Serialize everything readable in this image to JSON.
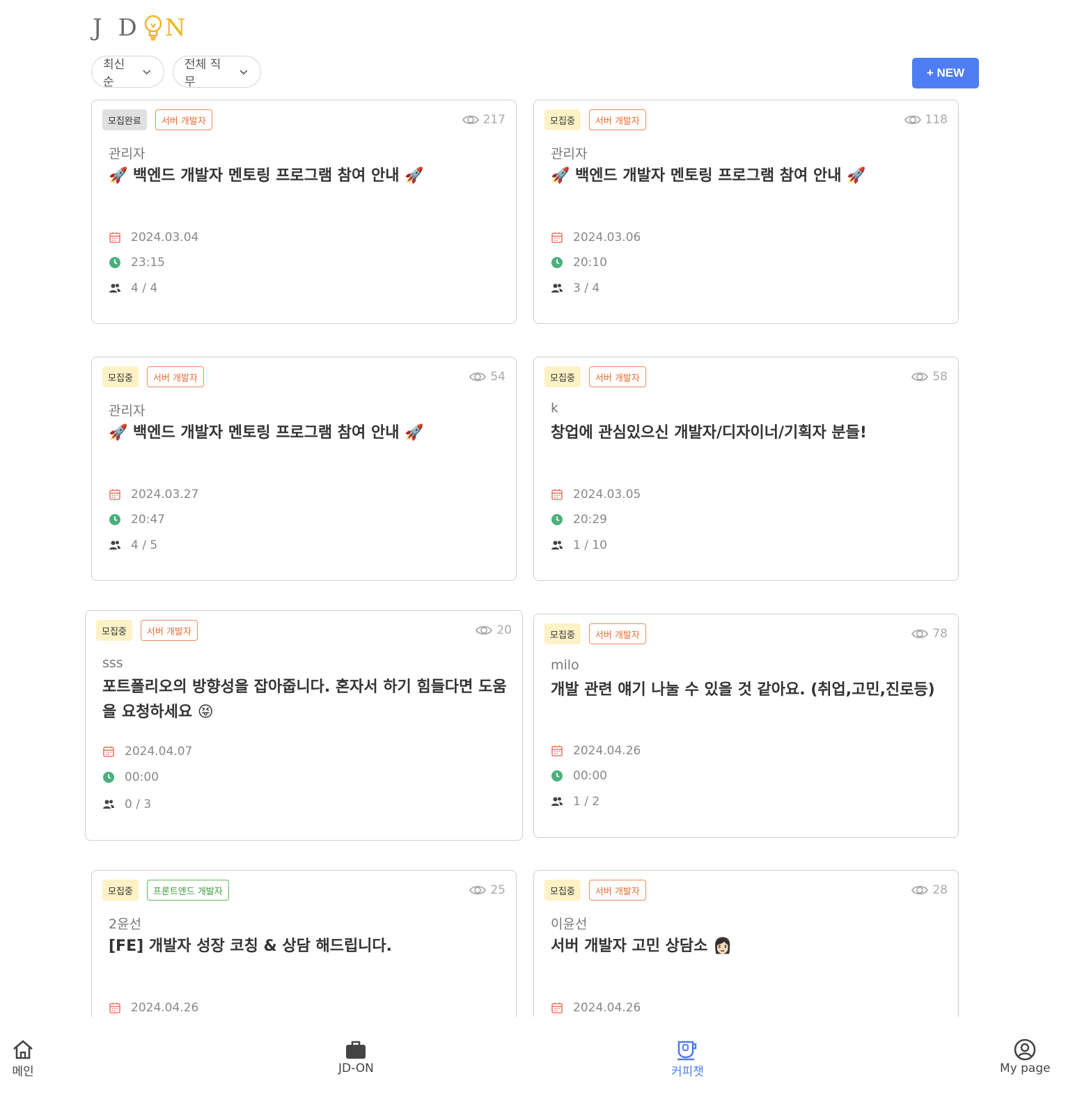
{
  "header": {
    "logo": "JDON"
  },
  "filters": {
    "sort_label": "최신순",
    "job_label": "전체 직무"
  },
  "new_button": {
    "label": "+ NEW"
  },
  "posts": [
    {
      "status": "모집완료",
      "role": "서버 개발자",
      "views": "217",
      "author": "관리자",
      "title": "🚀 백엔드 개발자 멘토링 프로그램 참여 안내 🚀",
      "date": "2024.03.04",
      "time": "23:15",
      "members": "4 / 4"
    },
    {
      "status": "모집중",
      "role": "서버 개발자",
      "views": "118",
      "author": "관리자",
      "title": "🚀 백엔드 개발자 멘토링 프로그램 참여 안내 🚀",
      "date": "2024.03.06",
      "time": "20:10",
      "members": "3 / 4"
    },
    {
      "status": "모집중",
      "role": "서버 개발자",
      "views": "54",
      "author": "관리자",
      "title": "🚀 백엔드 개발자 멘토링 프로그램 참여 안내 🚀",
      "date": "2024.03.27",
      "time": "20:47",
      "members": "4 / 5"
    },
    {
      "status": "모집중",
      "role": "서버 개발자",
      "views": "58",
      "author": "k",
      "title": "창업에 관심있으신 개발자/디자이너/기획자 분들!",
      "date": "2024.03.05",
      "time": "20:29",
      "members": "1 / 10"
    },
    {
      "status": "모집중",
      "role": "서버 개발자",
      "views": "20",
      "author": "sss",
      "title": "포트폴리오의 방향성을 잡아줍니다. 혼자서 하기 힘들다면 도움을 요청하세요 😝",
      "date": "2024.04.07",
      "time": "00:00",
      "members": "0 / 3"
    },
    {
      "status": "모집중",
      "role": "서버 개발자",
      "views": "78",
      "author": "milo",
      "title": "개발 관련 얘기 나눌 수 있을 것 같아요. (취업,고민,진로등)",
      "date": "2024.04.26",
      "time": "00:00",
      "members": "1 / 2"
    },
    {
      "status": "모집중",
      "role": "프론트엔드 개발자",
      "views": "25",
      "author": "2윤선",
      "title": "[FE] 개발자 성장 코칭 & 상담 해드립니다.",
      "date": "2024.04.26"
    },
    {
      "status": "모집중",
      "role": "서버 개발자",
      "views": "28",
      "author": "이윤선",
      "title": "서버 개발자 고민 상담소 👩🏻",
      "date": "2024.04.26"
    }
  ],
  "nav": {
    "home": "메인",
    "jdon": "JD-ON",
    "coffee": "커피챗",
    "mypage": "My page"
  },
  "colors": {
    "accent": "#4f7df3",
    "status_open": "#fdf2c6",
    "status_done": "#e0e0e0",
    "role_server": "#ef6a2f",
    "role_frontend": "#3a9a3a"
  }
}
